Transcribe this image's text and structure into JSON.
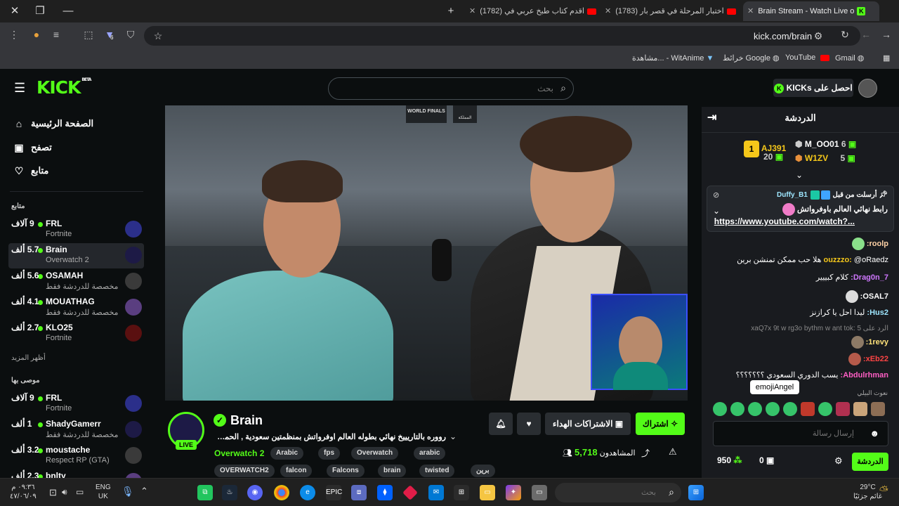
{
  "browser": {
    "tabs": [
      {
        "label": "Brain Stream - Watch Live o",
        "active": true
      },
      {
        "label": "(1783) اختبار المرحلة في قصر بار",
        "active": false
      },
      {
        "label": "(1782) اقدم كتاب طبخ عربي في",
        "active": false
      }
    ],
    "url": "kick.com/brain",
    "bookmarks": [
      "Gmail",
      "YouTube",
      "خرائط Google",
      "مشاهدة... - WitAnime"
    ],
    "extension_badge": "6"
  },
  "kick": {
    "logo": "KICK",
    "logo_beta": "BETA",
    "search_placeholder": "بحث",
    "get_kicks": "احصل على KICKs"
  },
  "sidebar": {
    "nav": [
      {
        "label": "الصفحة الرئيسية",
        "icon": "home-icon"
      },
      {
        "label": "تصفح",
        "icon": "browse-icon"
      },
      {
        "label": "متابع",
        "icon": "heart-icon"
      }
    ],
    "following_title": "متابع",
    "following": [
      {
        "name": "FRL",
        "viewers": "9 آلاف",
        "game": "Fortnite"
      },
      {
        "name": "Brain",
        "viewers": "5.7 ألف",
        "game": "Overwatch 2"
      },
      {
        "name": "OSAMAH",
        "viewers": "5.6 ألف",
        "game": "مخصصة للدردشة فقط"
      },
      {
        "name": "MOUATHAG",
        "viewers": "4.1 ألف",
        "game": "مخصصة للدردشة فقط"
      },
      {
        "name": "KLO25",
        "viewers": "2.7 ألف",
        "game": "Fortnite"
      }
    ],
    "show_more": "أظهر المزيد",
    "recommended_title": "موصى بها",
    "recommended": [
      {
        "name": "FRL",
        "viewers": "9 آلاف",
        "game": "Fortnite"
      },
      {
        "name": "ShadyGamerr",
        "viewers": "1 ألف",
        "game": "مخصصة للدردشة فقط"
      },
      {
        "name": "moustache",
        "viewers": "3.2 ألف",
        "game": "Respect RP (GTA)"
      },
      {
        "name": "bnlty",
        "viewers": "2.3 ألف",
        "game": ""
      }
    ]
  },
  "video": {
    "overlay_world_finals": "WORLD FINALS",
    "overlay_kingdom": "المملكة"
  },
  "stream": {
    "name": "Brain",
    "live": "LIVE",
    "title": "رووره بالتاريييخ نهائي بطوله العالم اوفرواتش بمنظمتين سعودية , الحمممممحق...",
    "category": "Overwatch 2",
    "tags_row1": [
      "Arabic",
      "fps",
      "Overwatch",
      "arabic"
    ],
    "tags_row2": [
      "OVERWATCH2",
      "falcon",
      "Falcons",
      "brain",
      "twisted",
      "برين"
    ],
    "viewers_count": "5,718",
    "viewers_label": "المشاهدون",
    "subscribe": "اشتراك",
    "gift_subs": "الاشتراكات الهداء"
  },
  "chat": {
    "title": "الدردشة",
    "leaderboard": [
      {
        "name": "AJ391",
        "value": "20"
      },
      {
        "name": "M_OO01",
        "value": "6"
      },
      {
        "name": "W1ZV",
        "value": "5"
      }
    ],
    "pinned": {
      "sender": "Duffy_B1",
      "label": "أرسلت من قبل",
      "text": "رابط نهائي العالم باوفرواتش",
      "link": "https://www.youtube.com/watch?..."
    },
    "messages": [
      {
        "user": "roolp:",
        "text": "",
        "color": "#ffd2a6"
      },
      {
        "user": "ouzzzo:",
        "text": "@oRaedz هلا حب ممكن تمنشن برين",
        "color": "#f5c71a"
      },
      {
        "user": "7_Drag0n:",
        "text": "كلام كبييير",
        "color": "#cf77ff"
      },
      {
        "user": "OSAL7:",
        "text": "",
        "color": "#ffffff"
      },
      {
        "user": "Hus2:",
        "text": "ليدا احل يا كرازنز",
        "color": "#9ee6ff"
      },
      {
        "user": "",
        "text": "الرد على 5 :xaQ7x 9t w rg3o bythm w ant tok",
        "color": "#888888"
      },
      {
        "user": "1revy:",
        "text": "",
        "color": "#ffe27a"
      },
      {
        "user": "xEb22:",
        "text": "",
        "color": "#ff4444"
      },
      {
        "user": "Abdulrhman:",
        "text": "يسب الدوري السعودي ؟؟؟؟؟؟؟",
        "color": "#ff5ec4"
      }
    ],
    "tooltip": "emojiAngel",
    "recent_label": "نعوت البيلي",
    "input_placeholder": "إرسال رسالة",
    "points": "950",
    "gifts": "0",
    "send": "الدردشة"
  },
  "taskbar": {
    "search_placeholder": "بحث",
    "weather_temp": "29°C",
    "weather_text": "غائم جزئيًا",
    "lang": "ENG",
    "region": "UK",
    "time": "٠٩:٣٦ م",
    "date": "٤٧/٠٦/٠٩"
  }
}
